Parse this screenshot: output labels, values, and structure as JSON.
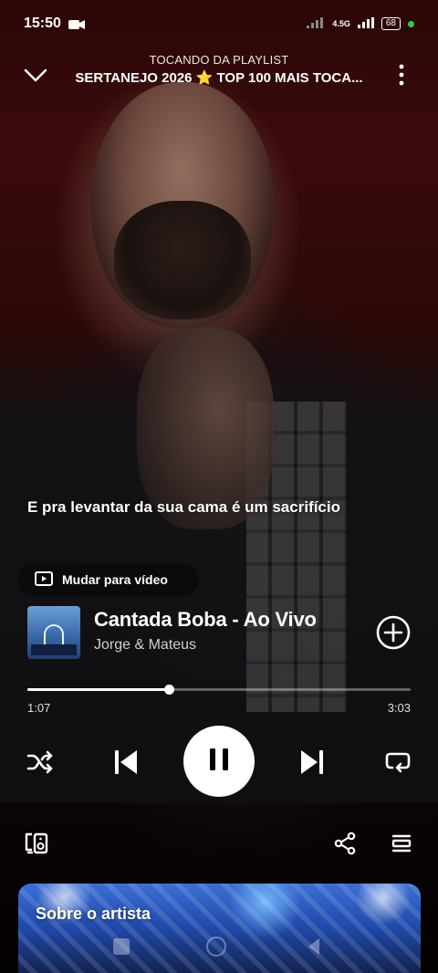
{
  "status_bar": {
    "time": "15:50",
    "network": "4.5G",
    "battery": "68"
  },
  "header": {
    "subtitle": "TOCANDO DA PLAYLIST",
    "title": "SERTANEJO 2026 ⭐ TOP 100 MAIS TOCA..."
  },
  "lyric": "E pra levantar da sua cama é um sacrifício",
  "video_toggle": {
    "label": "Mudar para vídeo"
  },
  "track": {
    "title": "Cantada Boba - Ao Vivo",
    "artist": "Jorge & Mateus"
  },
  "playback": {
    "current_time": "1:07",
    "total_time": "3:03",
    "progress": 0.37,
    "state": "playing"
  },
  "artist_section": {
    "label": "Sobre o artista"
  },
  "colors": {
    "accent": "#ffffff",
    "background_top": "#3b0b0b",
    "status_dot": "#2ecc40"
  },
  "icons": {
    "header_left": "chevron-down-icon",
    "header_right": "more-vertical-icon",
    "add": "add-circle-icon",
    "shuffle": "shuffle-icon",
    "previous": "skip-previous-icon",
    "pause": "pause-icon",
    "next": "skip-next-icon",
    "repeat": "repeat-icon",
    "devices": "connect-device-icon",
    "share": "share-icon",
    "queue": "queue-icon"
  }
}
